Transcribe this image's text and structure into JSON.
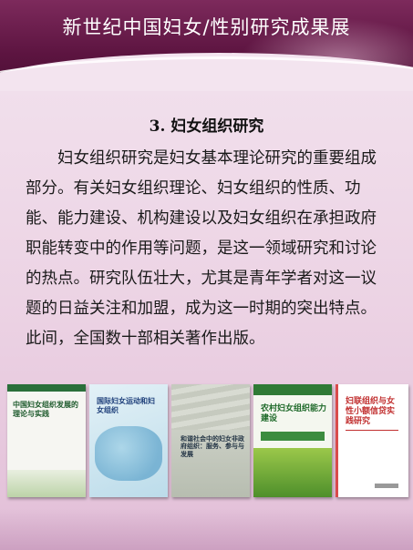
{
  "header": {
    "title": "新世纪中国妇女/性别研究成果展"
  },
  "section": {
    "title": "3. 妇女组织研究",
    "paragraph": "妇女组织研究是妇女基本理论研究的重要组成部分。有关妇女组织理论、妇女组织的性质、功能、能力建设、机构建设以及妇女组织在承担政府职能转变中的作用等问题，是这一领域研究和讨论的热点。研究队伍壮大，尤其是青年学者对这一议题的日益关注和加盟，成为这一时期的突出特点。此间，全国数十部相关著作出版。"
  },
  "books": [
    {
      "title": "中国妇女组织发展的理论与实践"
    },
    {
      "title": "国际妇女运动和妇女组织"
    },
    {
      "title": "和谐社会中的妇女非政府组织：服务、参与与发展"
    },
    {
      "title": "农村妇女组织能力建设"
    },
    {
      "title": "妇联组织与女性小额信贷实践研究"
    }
  ]
}
